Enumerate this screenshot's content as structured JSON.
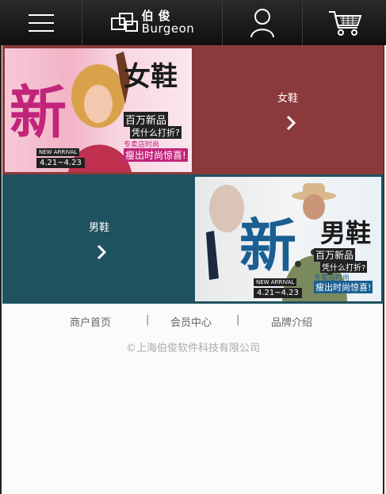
{
  "header": {
    "menu_icon": "hamburger-menu-icon",
    "logo": {
      "cn": "伯俊",
      "en": "Burgeon"
    },
    "user_icon": "user-icon",
    "cart_icon": "cart-icon"
  },
  "tiles": [
    {
      "label": "女鞋",
      "bg": "#8b3a3b",
      "banner": {
        "big": "新",
        "title": "女鞋",
        "line1": "百万新品",
        "line2": "凭什么打折?",
        "line3": "专卖店时尚",
        "badge": "NEW ARRIVAL",
        "dates": "4.21~4.23",
        "slogan": "瘦出时尚惊喜!"
      }
    },
    {
      "label": "男鞋",
      "bg": "#1f5260",
      "banner": {
        "big": "新",
        "title": "男鞋",
        "line1": "百万新品",
        "line2": "凭什么打折?",
        "line3": "专卖店时尚",
        "badge": "NEW ARRIVAL",
        "dates": "4.21~4.23",
        "slogan": "瘦出时尚惊喜!"
      }
    }
  ],
  "footer": {
    "links": [
      "商户首页",
      "会员中心",
      "品牌介绍"
    ],
    "separator": "|",
    "copyright": "©上海伯俊软件科技有限公司"
  }
}
